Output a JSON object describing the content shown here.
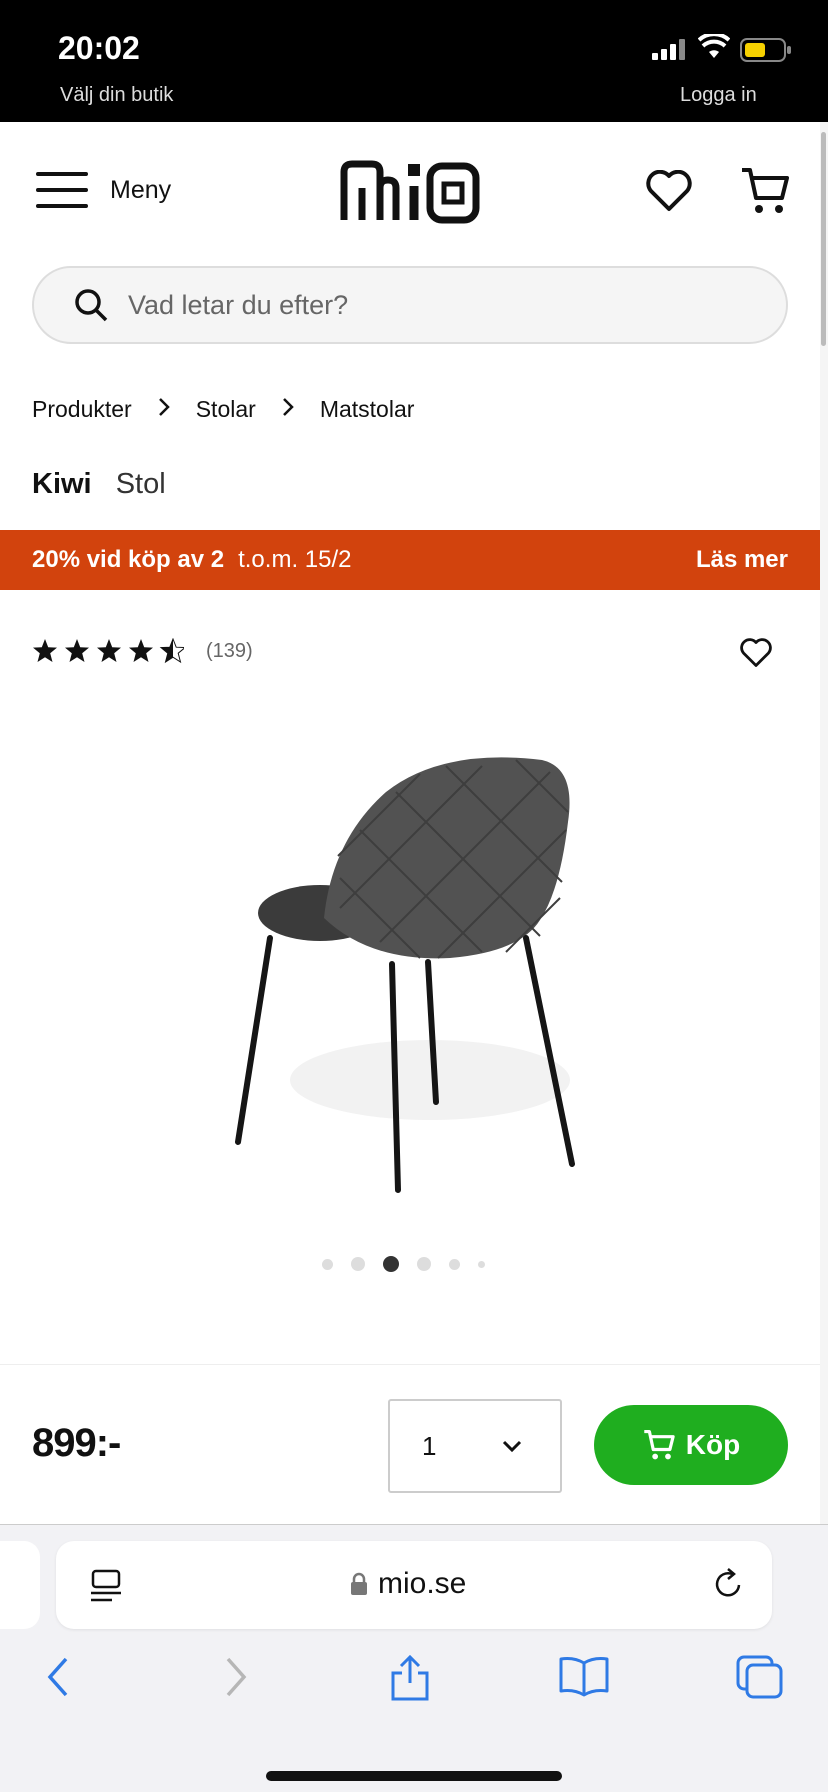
{
  "status_bar": {
    "time": "20:02",
    "left_clipped": "Välj din butik",
    "right_clipped": "Logga in"
  },
  "header": {
    "menu_label": "Meny",
    "logo_text": "mio"
  },
  "search": {
    "placeholder": "Vad letar du efter?"
  },
  "breadcrumb": [
    "Produkter",
    "Stolar",
    "Matstolar"
  ],
  "product": {
    "brand": "Kiwi",
    "type": "Stol",
    "rating_value": 4.5,
    "review_count": "(139)",
    "image_count": 6,
    "active_image": 3
  },
  "promo": {
    "offer": "20% vid köp av 2",
    "date": "t.o.m. 15/2",
    "more": "Läs mer",
    "color": "#d2430d"
  },
  "buy": {
    "price": "899:-",
    "quantity": "1",
    "button_label": "Köp",
    "button_color": "#1fae1f"
  },
  "browser": {
    "url": "mio.se"
  }
}
